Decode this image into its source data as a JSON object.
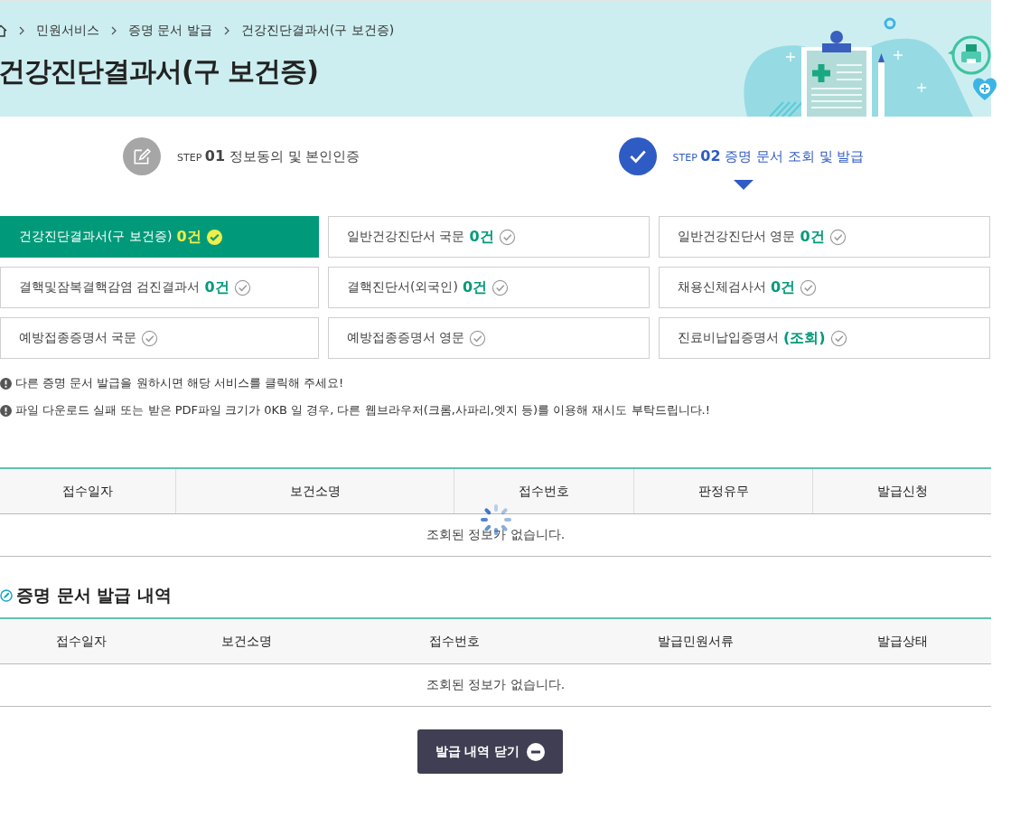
{
  "breadcrumb": [
    "민원서비스",
    "증명 문서 발급",
    "건강진단결과서(구 보건증)"
  ],
  "title": "건강진단결과서(구 보건증)",
  "steps": [
    {
      "prefix": "STEP",
      "number": "01",
      "label": "정보동의 및 본인인증",
      "selected": false
    },
    {
      "prefix": "STEP",
      "number": "02",
      "label": "증명 문서 조회 및 발급",
      "selected": true
    }
  ],
  "documents": [
    {
      "label": "건강진단결과서(구 보건증)",
      "count": "0건",
      "selected": true
    },
    {
      "label": "일반건강진단서 국문",
      "count": "0건",
      "selected": false
    },
    {
      "label": "일반건강진단서 영문",
      "count": "0건",
      "selected": false
    },
    {
      "label": "결핵및잠복결핵감염 검진결과서",
      "count": "0건",
      "selected": false
    },
    {
      "label": "결핵진단서(외국인)",
      "count": "0건",
      "selected": false
    },
    {
      "label": "채용신체검사서",
      "count": "0건",
      "selected": false
    },
    {
      "label": "예방접종증명서 국문",
      "selected": false
    },
    {
      "label": "예방접종증명서 영문",
      "selected": false
    },
    {
      "label": "진료비납입증명서",
      "count": "(조회)",
      "selected": false
    }
  ],
  "notices": [
    "다른 증명 문서 발급을 원하시면 해당 서비스를 클릭해 주세요!",
    "파일 다운로드 실패 또는 받은 PDF파일 크기가 0KB 일 경우, 다른 웹브라우저(크롬,사파리,엣지 등)를 이용해 재시도 부탁드립니다.!"
  ],
  "results_table": {
    "columns": [
      "접수일자",
      "보건소명",
      "접수번호",
      "판정유무",
      "발급신청"
    ],
    "empty_message": "조회된 정보가 없습니다.",
    "loading": true
  },
  "history": {
    "title": "증명 문서 발급 내역",
    "table": {
      "columns": [
        "접수일자",
        "보건소명",
        "접수번호",
        "발급민원서류",
        "발급상태"
      ],
      "empty_message": "조회된 정보가 없습니다."
    },
    "close_button": "발급 내역 닫기"
  }
}
